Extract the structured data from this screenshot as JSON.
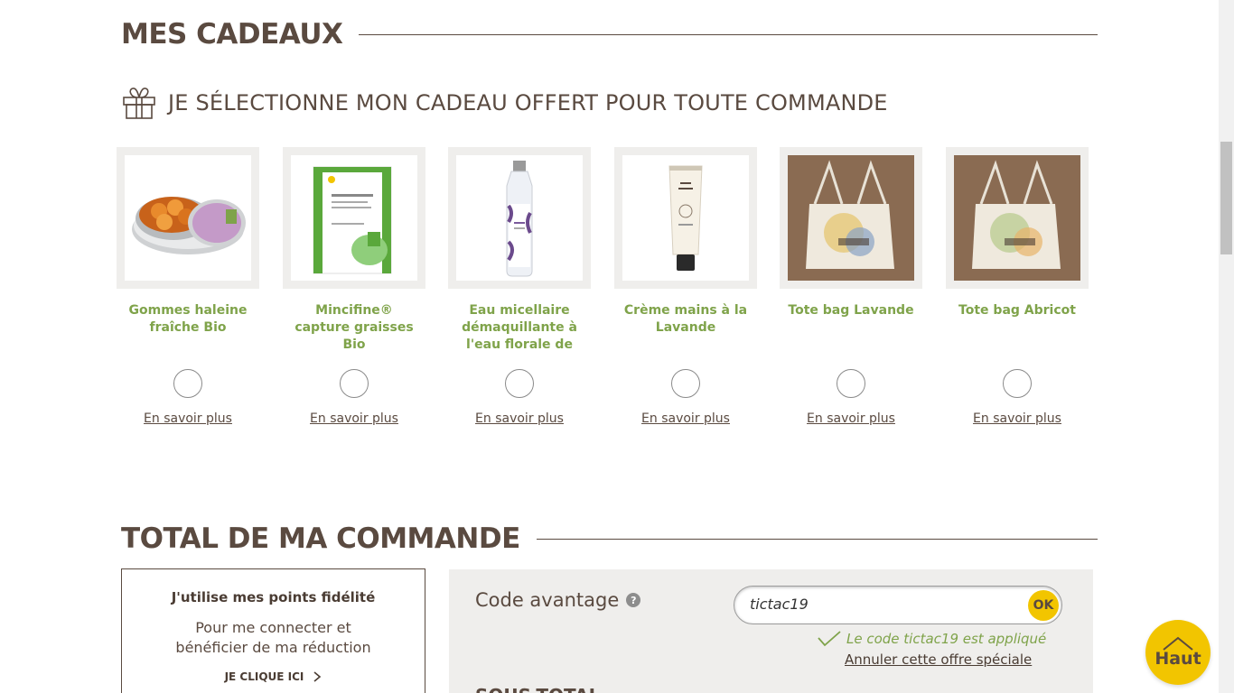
{
  "gifts_section": {
    "title": "MES CADEAUX",
    "subtitle": "JE SÉLECTIONNE MON CADEAU OFFERT POUR TOUTE COMMANDE",
    "more_label": "En savoir plus",
    "items": [
      {
        "name": "Gommes haleine fraîche Bio"
      },
      {
        "name": "Mincifine® capture graisses Bio"
      },
      {
        "name": "Eau micellaire démaquillante à l'eau florale de"
      },
      {
        "name": "Crème mains à la Lavande"
      },
      {
        "name": "Tote bag Lavande"
      },
      {
        "name": "Tote bag Abricot"
      }
    ]
  },
  "total_section": {
    "title": "TOTAL DE MA COMMANDE",
    "fidelity": {
      "title": "J'utilise mes points fidélité",
      "description_line1": "Pour me connecter et",
      "description_line2": "bénéficier de ma réduction",
      "cta": "JE CLIQUE ICI"
    },
    "promo": {
      "label": "Code avantage",
      "help": "?",
      "code_value": "tictac19",
      "ok_label": "OK",
      "applied_message": "Le code tictac19 est appliqué",
      "cancel_label": "Annuler cette offre spéciale",
      "subtotal_label": "SOUS-TOTAL"
    }
  },
  "back_to_top": {
    "label": "Haut"
  },
  "colors": {
    "brand_brown": "#5a4a40",
    "brand_green": "#7fa34a",
    "accent_yellow": "#f2c500",
    "panel_grey": "#efeeec"
  }
}
